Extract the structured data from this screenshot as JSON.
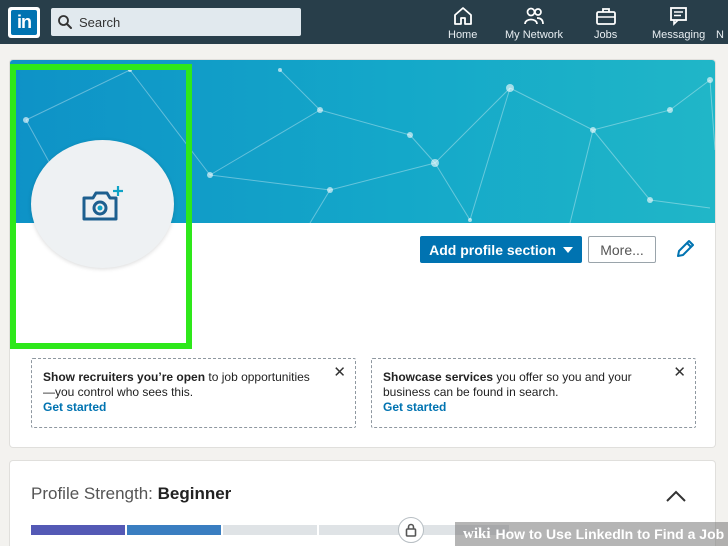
{
  "nav": {
    "logo_text": "in",
    "search_placeholder": "Search",
    "items": [
      {
        "label": "Home",
        "icon": "home-icon"
      },
      {
        "label": "My Network",
        "icon": "network-icon"
      },
      {
        "label": "Jobs",
        "icon": "briefcase-icon"
      },
      {
        "label": "Messaging",
        "icon": "messaging-icon"
      },
      {
        "label": "N",
        "icon": "notifications-icon"
      }
    ]
  },
  "profile": {
    "add_section_label": "Add profile section",
    "more_label": "More...",
    "promos": [
      {
        "bold": "Show recruiters you’re open",
        "text": " to job opportunities —you control who sees this.",
        "cta": "Get started",
        "close": "✕"
      },
      {
        "bold": "Showcase services",
        "text": " you offer so you and your business can be found in search.",
        "cta": "Get started",
        "close": "✕"
      }
    ]
  },
  "strength": {
    "label": "Profile Strength: ",
    "level": "Beginner",
    "filled_segments": 2,
    "total_segments": 5
  },
  "watermark": {
    "brand": "wiki",
    "text": "How to Use LinkedIn to Find a Job"
  },
  "colors": {
    "nav_bg": "#283e4a",
    "brand_blue": "#0073b1",
    "highlight_green": "#2ee81a",
    "meter_filled_1": "#5459b5",
    "meter_filled_2": "#3a7ec1",
    "meter_empty": "#dfe3e6"
  }
}
